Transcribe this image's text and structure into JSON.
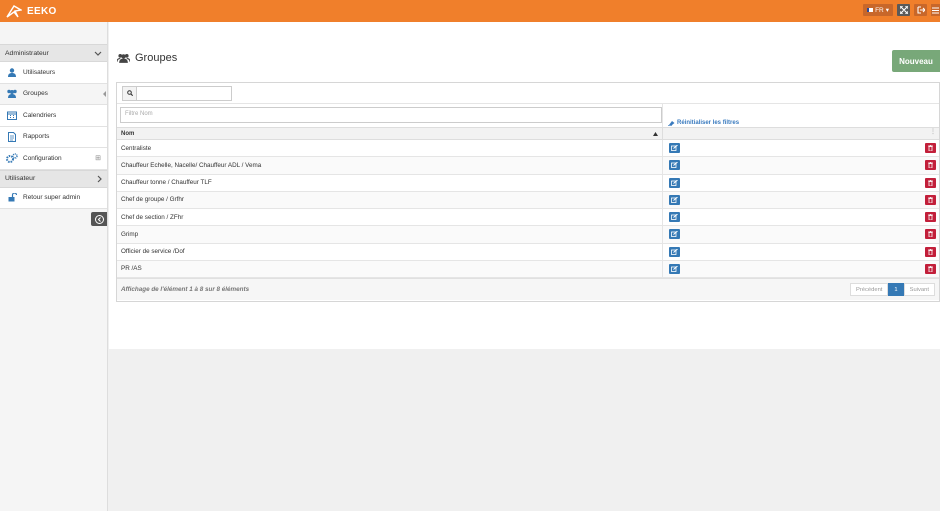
{
  "app": {
    "name": "EEKO"
  },
  "topbar": {
    "language": "FR"
  },
  "sidebar": {
    "section_admin": "Administrateur",
    "admin_items": [
      {
        "label": "Utilisateurs"
      },
      {
        "label": "Groupes"
      },
      {
        "label": "Calendriers"
      },
      {
        "label": "Rapports"
      },
      {
        "label": "Configuration"
      }
    ],
    "section_user": "Utilisateur",
    "user_items": [
      {
        "label": "Retour super admin"
      }
    ]
  },
  "page": {
    "title": "Groupes",
    "new_button": "Nouveau"
  },
  "table": {
    "search_value": "",
    "filter_placeholder": "Filtre Nom",
    "reset_filters": "Réinitialiser les filtres",
    "column_name": "Nom",
    "rows": [
      "Centraliste",
      "Chauffeur Echelle, Nacelle/ Chauffeur ADL / Vema",
      "Chauffeur tonne / Chauffeur TLF",
      "Chef de groupe / Grfhr",
      "Chef de section / ZFhr",
      "Grimp",
      "Officier de service /Dof",
      "PR /AS"
    ],
    "info": "Affichage de l'élément 1 à 8 sur 8 éléments",
    "pager": {
      "previous": "Précédent",
      "current": "1",
      "next": "Suivant"
    }
  },
  "colors": {
    "brand": "#f07f2b",
    "primary": "#3579b5",
    "danger": "#c21f3a",
    "success": "#78a879"
  }
}
